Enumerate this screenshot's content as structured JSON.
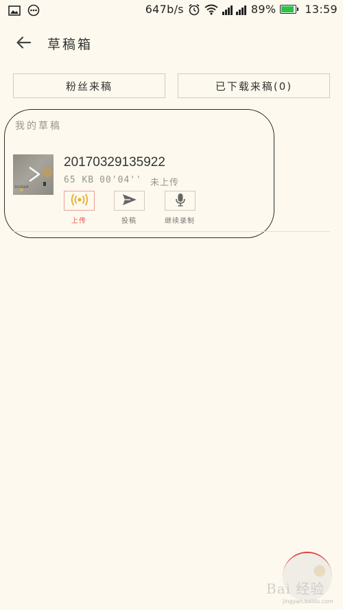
{
  "status_bar": {
    "net_speed": "647b/s",
    "battery_percent": "89%",
    "battery_level": 0.89,
    "time": "13:59",
    "icons": [
      "image-icon",
      "message-icon",
      "alarm-icon",
      "wifi-icon",
      "signal-icon",
      "battery-icon"
    ]
  },
  "header": {
    "title": "草稿箱",
    "back_icon": "arrow-left-icon"
  },
  "tabs": [
    {
      "label": "粉丝来稿"
    },
    {
      "label": "已下载来稿(0)"
    }
  ],
  "drafts": {
    "section_title": "我的草稿",
    "items": [
      {
        "name": "20170329135922",
        "size": "65 KB",
        "duration": "00'04''",
        "status": "未上传",
        "thumb_text": "20170329",
        "actions": [
          {
            "label": "上传",
            "icon": "broadcast-icon",
            "color": "#e8b13a"
          },
          {
            "label": "投稿",
            "icon": "send-icon",
            "color": "#666666"
          },
          {
            "label": "继续录制",
            "icon": "microphone-icon",
            "color": "#666666"
          }
        ]
      }
    ]
  },
  "watermark": {
    "text": "Bai 经验",
    "url": "jingyan.baidu.com"
  },
  "colors": {
    "background": "#fdf9ee",
    "accent_upload": "#e0584c",
    "battery": "#2bc24a"
  }
}
